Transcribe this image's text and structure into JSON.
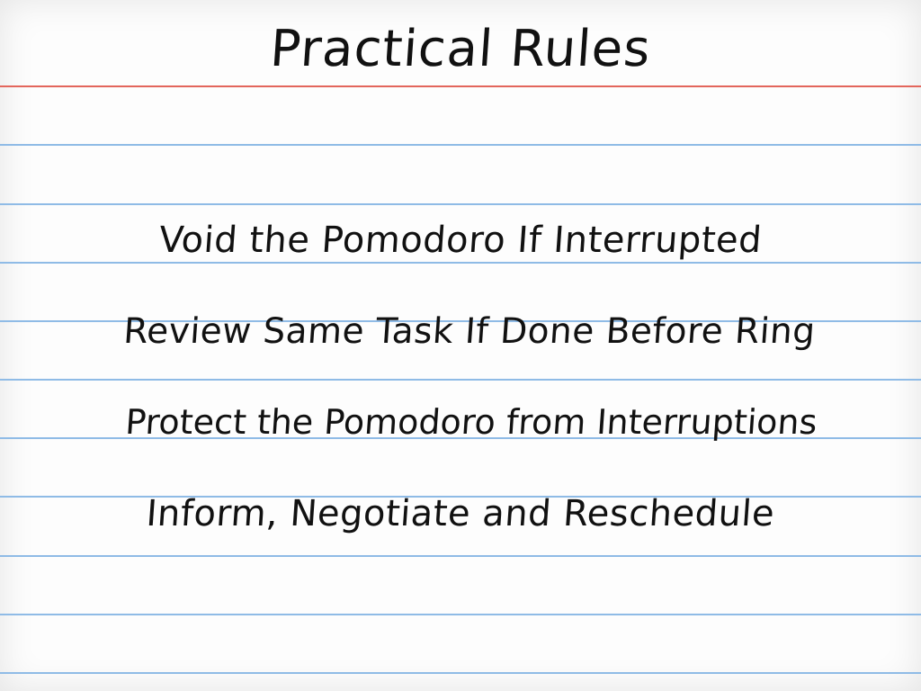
{
  "title": "Practical Rules",
  "rules": [
    "Void the Pomodoro If Interrupted",
    "Review Same Task If Done Before Ring",
    "Protect the Pomodoro from Interruptions",
    "Inform, Negotiate and Reschedule"
  ],
  "colors": {
    "margin_line": "#e3665c",
    "ruled_line": "#8fbbe6",
    "ink": "#111111",
    "paper": "#fdfdfd"
  }
}
